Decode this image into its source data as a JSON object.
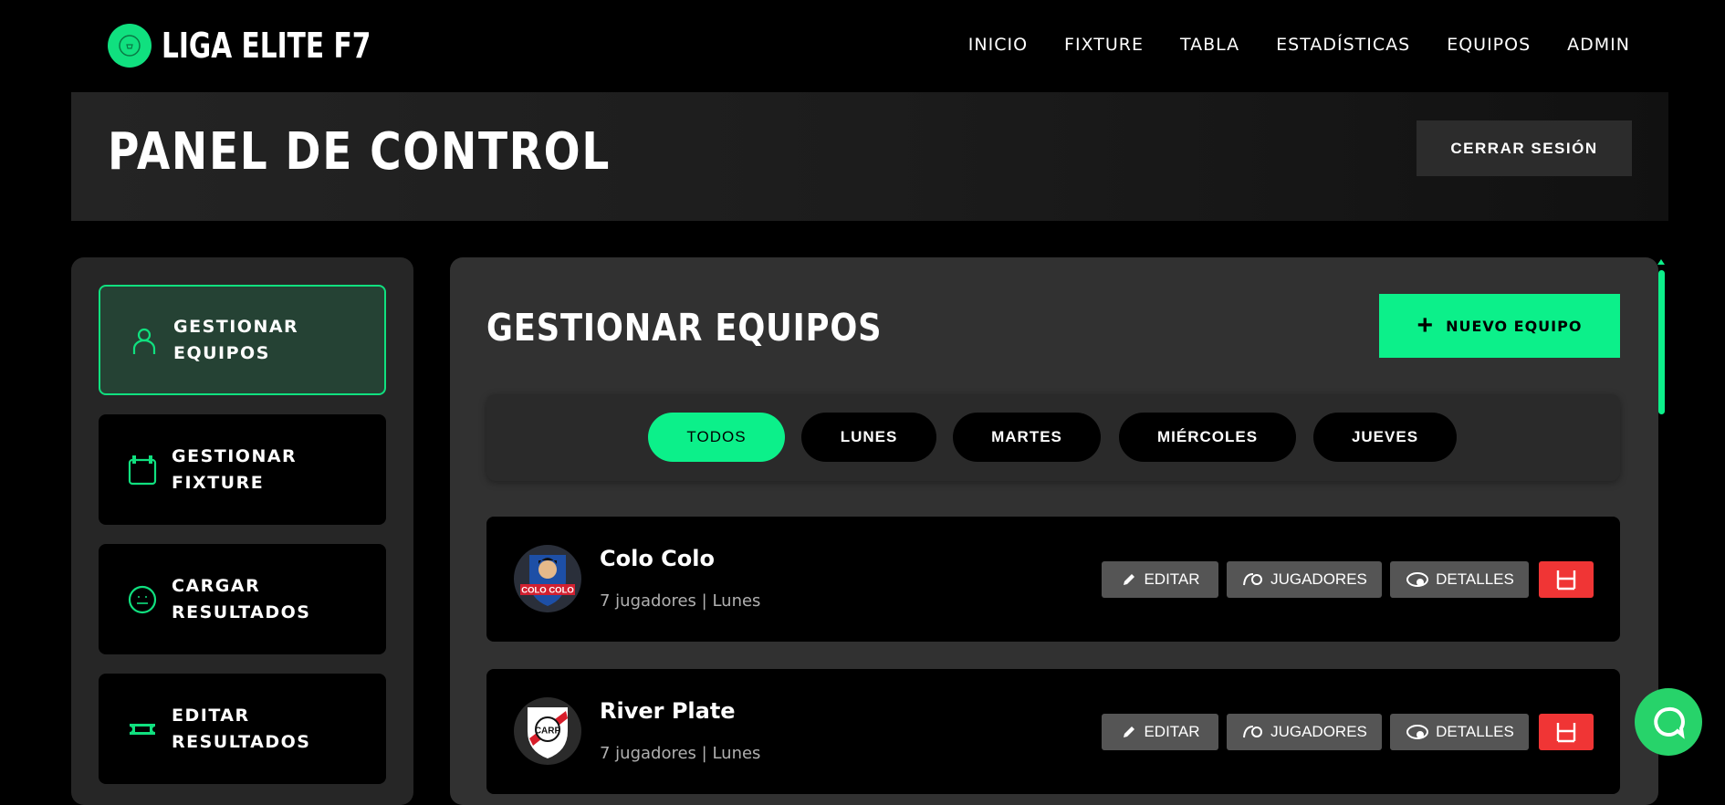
{
  "brand": {
    "title": "LIGA ELITE F7"
  },
  "nav": {
    "items": [
      "INICIO",
      "FIXTURE",
      "TABLA",
      "ESTADÍSTICAS",
      "EQUIPOS",
      "ADMIN"
    ]
  },
  "header": {
    "title": "PANEL DE CONTROL",
    "logout_label": "CERRAR SESIÓN"
  },
  "sidebar": {
    "items": [
      {
        "label": "GESTIONAR EQUIPOS",
        "icon": "user-icon",
        "active": true
      },
      {
        "label": "GESTIONAR FIXTURE",
        "icon": "calendar-icon",
        "active": false
      },
      {
        "label": "CARGAR RESULTADOS",
        "icon": "ball-icon",
        "active": false
      },
      {
        "label": "EDITAR RESULTADOS",
        "icon": "ticket-icon",
        "active": false
      }
    ]
  },
  "main": {
    "title": "GESTIONAR EQUIPOS",
    "new_team_label": "NUEVO EQUIPO",
    "filters": [
      "TODOS",
      "LUNES",
      "MARTES",
      "MIÉRCOLES",
      "JUEVES"
    ],
    "active_filter": "TODOS",
    "actions": {
      "edit": "EDITAR",
      "players": "JUGADORES",
      "details": "DETALLES"
    },
    "teams": [
      {
        "name": "Colo Colo",
        "meta": "7 jugadores | Lunes",
        "logo_text": "COLO COLO"
      },
      {
        "name": "River Plate",
        "meta": "7 jugadores | Lunes",
        "logo_text": "CARP"
      }
    ]
  },
  "colors": {
    "accent": "#0cf08a",
    "danger": "#f03535",
    "panel": "#313131",
    "sidebar_active": "#254234"
  }
}
